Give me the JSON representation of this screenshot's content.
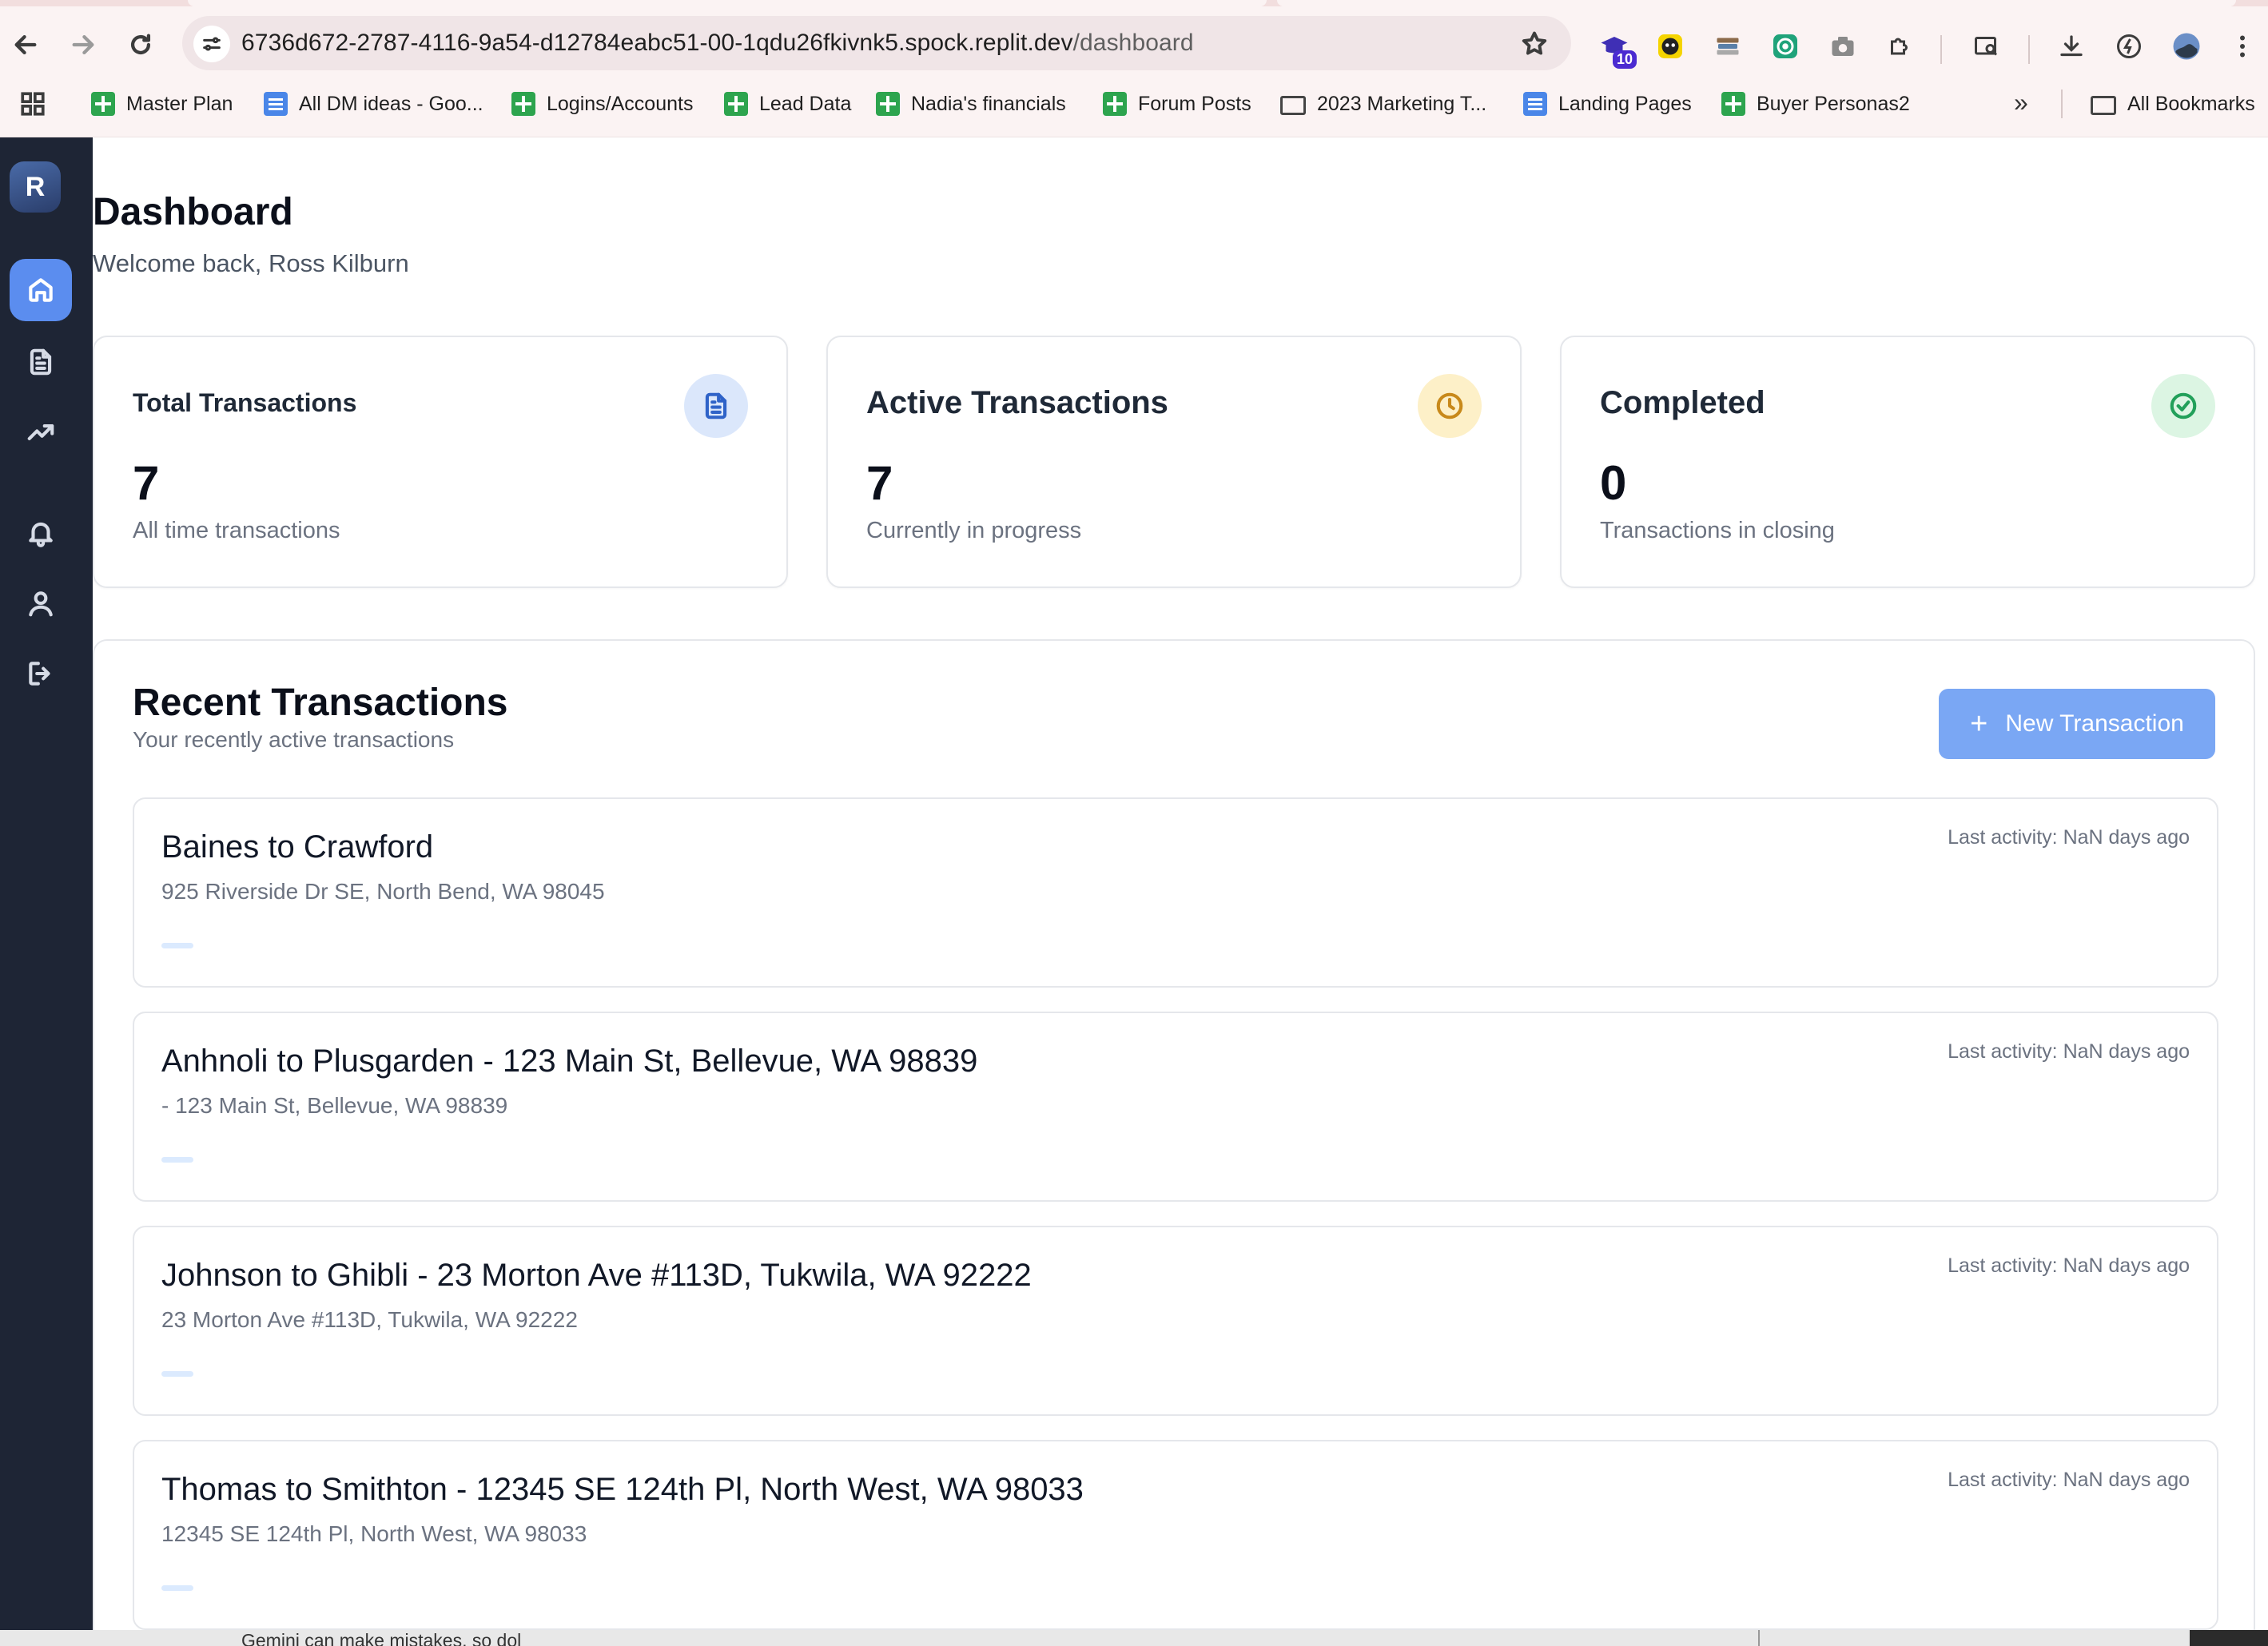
{
  "browser": {
    "url_host": "6736d672-2787-4116-9a54-d12784eabc51-00-1qdu26fkivnk5.spock.replit.dev",
    "url_path": "/dashboard",
    "extension_badge": "10",
    "bookmarks": [
      {
        "label": "Master Plan",
        "icon": "sheet-icon"
      },
      {
        "label": "All DM ideas - Goo...",
        "icon": "doc-icon"
      },
      {
        "label": "Logins/Accounts",
        "icon": "sheet-icon"
      },
      {
        "label": "Lead Data",
        "icon": "sheet-icon"
      },
      {
        "label": "Nadia's financials",
        "icon": "sheet-icon"
      },
      {
        "label": "Forum Posts",
        "icon": "sheet-icon"
      },
      {
        "label": "2023 Marketing T...",
        "icon": "folder-icon"
      },
      {
        "label": "Landing Pages",
        "icon": "doc-icon"
      },
      {
        "label": "Buyer Personas2",
        "icon": "sheet-icon"
      }
    ],
    "bookmarks_more": "»",
    "all_bookmarks": "All Bookmarks"
  },
  "sidebar": {
    "logo_letter": "R",
    "items": [
      {
        "name": "home",
        "icon": "home-icon",
        "active": true
      },
      {
        "name": "documents",
        "icon": "document-icon",
        "active": false
      },
      {
        "name": "analytics",
        "icon": "trending-up-icon",
        "active": false
      },
      {
        "name": "notifications",
        "icon": "bell-icon",
        "active": false
      },
      {
        "name": "profile",
        "icon": "user-icon",
        "active": false
      },
      {
        "name": "logout",
        "icon": "logout-icon",
        "active": false
      }
    ]
  },
  "header": {
    "title": "Dashboard",
    "welcome": "Welcome back, Ross Kilburn"
  },
  "stats": [
    {
      "title": "Total Transactions",
      "value": "7",
      "subtitle": "All time transactions",
      "icon": "document-icon",
      "color": "#2f63c8",
      "bg": "#dbe7fb"
    },
    {
      "title": "Active Transactions",
      "value": "7",
      "subtitle": "Currently in progress",
      "icon": "clock-icon",
      "color": "#c8891a",
      "bg": "#fdf0c8"
    },
    {
      "title": "Completed",
      "value": "0",
      "subtitle": "Transactions in closing",
      "icon": "check-circle-icon",
      "color": "#22a05a",
      "bg": "#dcf5e3"
    }
  ],
  "recent": {
    "title": "Recent Transactions",
    "subtitle": "Your recently active transactions",
    "new_button": "New Transaction",
    "transactions": [
      {
        "title": "Baines to Crawford",
        "address": "925 Riverside Dr SE, North Bend, WA 98045",
        "activity": "Last activity: NaN days ago"
      },
      {
        "title": "Anhnoli to Plusgarden - 123 Main St, Bellevue, WA 98839",
        "address": "- 123 Main St, Bellevue, WA 98839",
        "activity": "Last activity: NaN days ago"
      },
      {
        "title": "Johnson to Ghibli - 23 Morton Ave #113D, Tukwila, WA 92222",
        "address": "23 Morton Ave #113D, Tukwila, WA 92222",
        "activity": "Last activity: NaN days ago"
      },
      {
        "title": "Thomas to Smithton - 12345 SE 124th Pl, North West, WA 98033",
        "address": "12345 SE 124th Pl, North West, WA 98033",
        "activity": "Last activity: NaN days ago"
      }
    ]
  },
  "footer_snippet": "Gemini can make mistakes, so dol"
}
